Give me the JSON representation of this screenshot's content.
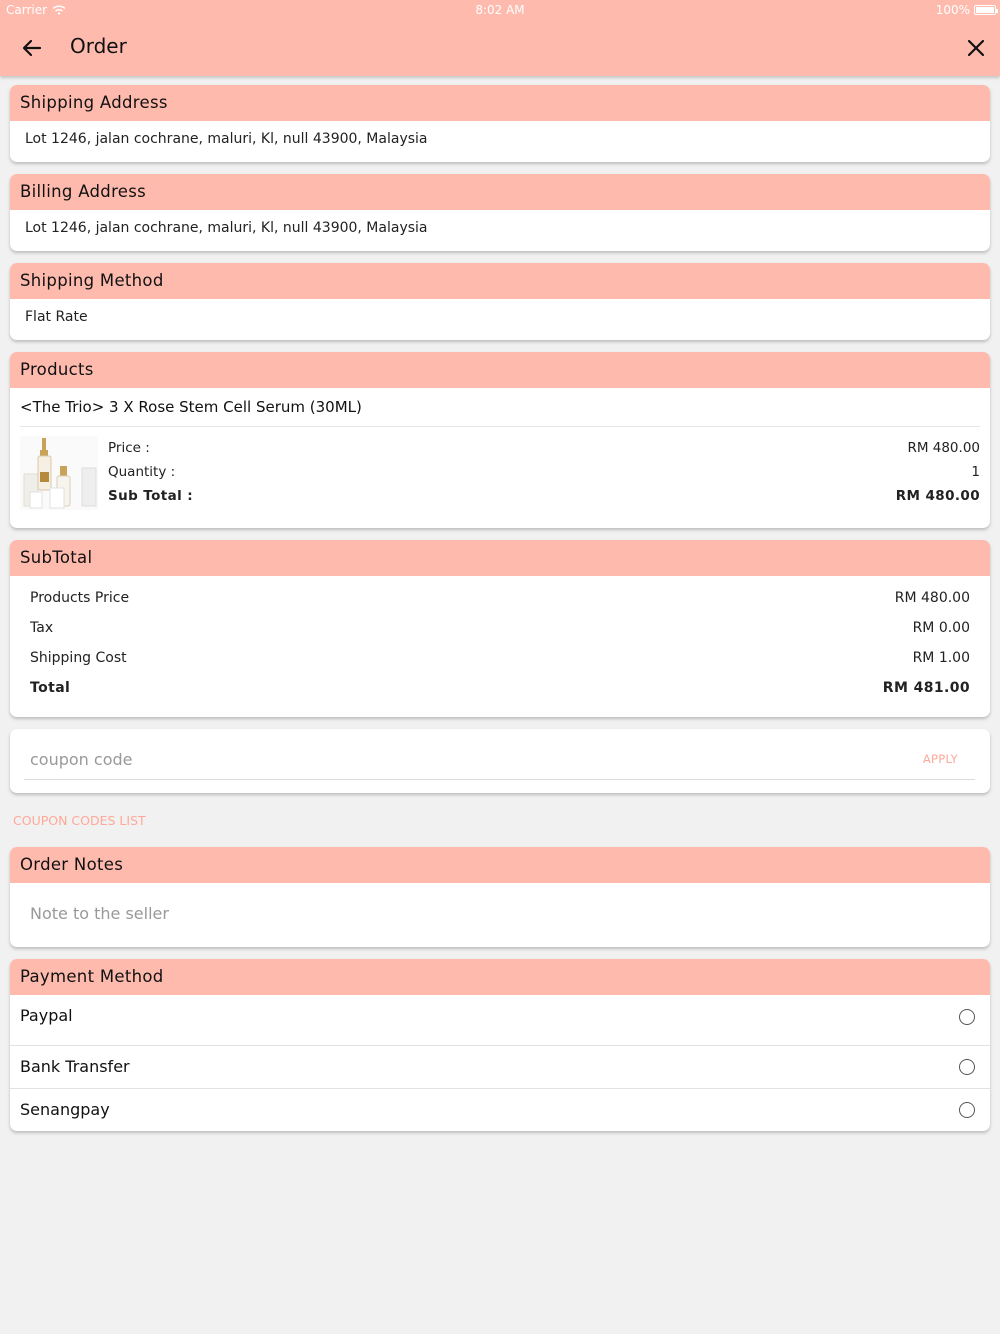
{
  "status_bar": {
    "carrier": "Carrier",
    "time": "8:02 AM",
    "battery": "100%"
  },
  "header": {
    "title": "Order",
    "back_icon": "arrow-left-icon",
    "close_icon": "close-icon"
  },
  "shipping_address": {
    "heading": "Shipping Address",
    "text": "Lot 1246, jalan cochrane, maluri, Kl, null 43900, Malaysia"
  },
  "billing_address": {
    "heading": "Billing Address",
    "text": "Lot 1246, jalan cochrane, maluri, Kl, null 43900, Malaysia"
  },
  "shipping_method": {
    "heading": "Shipping Method",
    "text": "Flat Rate"
  },
  "products": {
    "heading": "Products",
    "items": [
      {
        "name": "<The Trio> 3 X Rose Stem Cell Serum (30ML)",
        "price_label": "Price :",
        "price_value": "RM 480.00",
        "quantity_label": "Quantity :",
        "quantity_value": "1",
        "subtotal_label": "Sub Total :",
        "subtotal_value": "RM 480.00"
      }
    ]
  },
  "subtotal": {
    "heading": "SubTotal",
    "rows": [
      {
        "label": "Products Price",
        "value": "RM 480.00"
      },
      {
        "label": "Tax",
        "value": "RM 0.00"
      },
      {
        "label": "Shipping Cost",
        "value": "RM 1.00"
      },
      {
        "label": "Total",
        "value": "RM 481.00"
      }
    ]
  },
  "coupon": {
    "placeholder": "coupon code",
    "apply_label": "APPLY",
    "list_link": "COUPON CODES LIST"
  },
  "order_notes": {
    "heading": "Order Notes",
    "placeholder": "Note to the seller"
  },
  "payment_method": {
    "heading": "Payment Method",
    "options": [
      {
        "label": "Paypal",
        "selected": false
      },
      {
        "label": "Bank Transfer",
        "selected": false
      },
      {
        "label": "Senangpay",
        "selected": false
      }
    ]
  },
  "colors": {
    "header_bg": "#ffbaae",
    "accent_text": "#ffa898",
    "page_bg": "#f1f1f1"
  }
}
